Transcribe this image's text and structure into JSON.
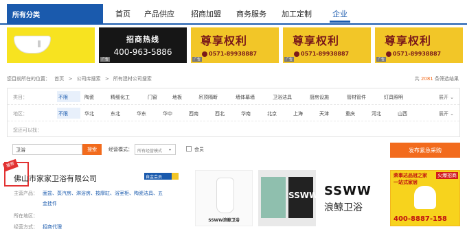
{
  "nav": {
    "category_label": "所有分类",
    "items": [
      "首页",
      "产品供应",
      "招商加盟",
      "商务服务",
      "加工定制",
      "企业"
    ],
    "active": "企业"
  },
  "banners": {
    "ad_tag": "广告",
    "hotline_title": "招商热线",
    "hotline_phone": "400-963-5886",
    "vip_title": "尊享权利",
    "vip_phone": "0571-89938887"
  },
  "breadcrumb": {
    "prefix": "您目前所在的位置：",
    "items": [
      "首页",
      ">",
      "公司库搜索",
      ">",
      "所有建材公司搜索"
    ],
    "total_prefix": "共",
    "total_count": "2081",
    "total_suffix": "条筛选结果"
  },
  "filters": {
    "category_label": "类目：",
    "category_options": [
      "不限",
      "陶瓷",
      "精细化工",
      "门窗",
      "地板",
      "吊顶隔断",
      "墙体幕墙",
      "卫浴洁具",
      "厨房设施",
      "管材管件",
      "灯具照明"
    ],
    "region_label": "地区：",
    "region_options": [
      "不限",
      "华北",
      "东北",
      "华东",
      "华中",
      "西南",
      "西北",
      "华南",
      "北京",
      "上海",
      "天津",
      "重庆",
      "河北",
      "山西"
    ],
    "more_label": "展开",
    "selected_label": "您还可以找："
  },
  "search": {
    "value": "卫浴",
    "button": "搜索",
    "mode_label": "经营模式：",
    "mode_select": "所有经营模式",
    "member_label": "会员",
    "urgent_button": "发布紧急采购"
  },
  "listing": {
    "rec_tag": "推荐",
    "company": "佛山市家家卫浴有限公司",
    "badge": "自金会员",
    "main_products_label": "主营产品：",
    "main_products_line1": "面盆、蒸汽房、淋浴房、按摩缸、浴室柜、陶瓷洁具、五",
    "main_products_line2": "金挂件",
    "region_label": "所在地区：",
    "region_value": "",
    "mode_label": "经营方式：",
    "mode_value": "招商代理"
  },
  "thumbs": {
    "t1_logo": "SSWW浪鲸卫浴",
    "t2_text": "SSWW",
    "t3_brand": "SSWW",
    "t3_cn": "浪鲸卫浴",
    "t4_line1": "荣事达品冠之家",
    "t4_line2": "一站式家居",
    "t4_hot": "火爆招商",
    "t4_phone": "400-8887-158"
  }
}
